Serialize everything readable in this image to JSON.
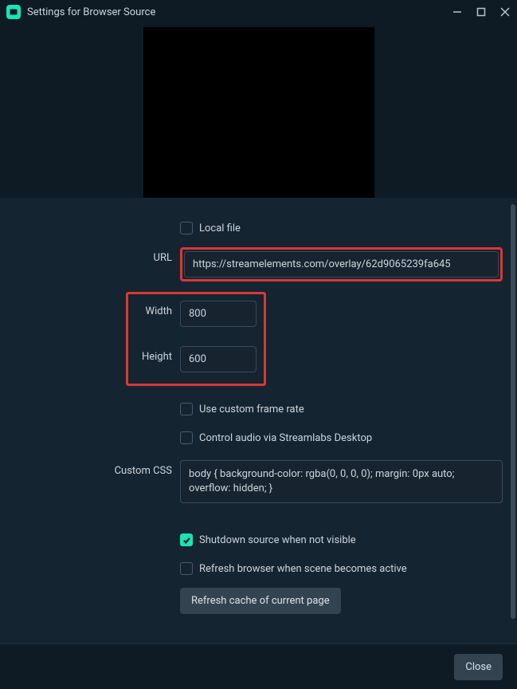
{
  "titlebar": {
    "title": "Settings for Browser Source"
  },
  "form": {
    "local_file": {
      "label": "Local file",
      "checked": false
    },
    "url": {
      "label": "URL",
      "value": "https://streamelements.com/overlay/62d9065239fa645"
    },
    "width": {
      "label": "Width",
      "value": "800"
    },
    "height": {
      "label": "Height",
      "value": "600"
    },
    "custom_fps": {
      "label": "Use custom frame rate",
      "checked": false
    },
    "control_audio": {
      "label": "Control audio via Streamlabs Desktop",
      "checked": false
    },
    "custom_css": {
      "label": "Custom CSS",
      "value": "body { background-color: rgba(0, 0, 0, 0); margin: 0px auto; overflow: hidden; }"
    },
    "shutdown": {
      "label": "Shutdown source when not visible",
      "checked": true
    },
    "refresh_active": {
      "label": "Refresh browser when scene becomes active",
      "checked": false
    },
    "refresh_cache_btn": "Refresh cache of current page"
  },
  "footer": {
    "close_btn": "Close"
  }
}
